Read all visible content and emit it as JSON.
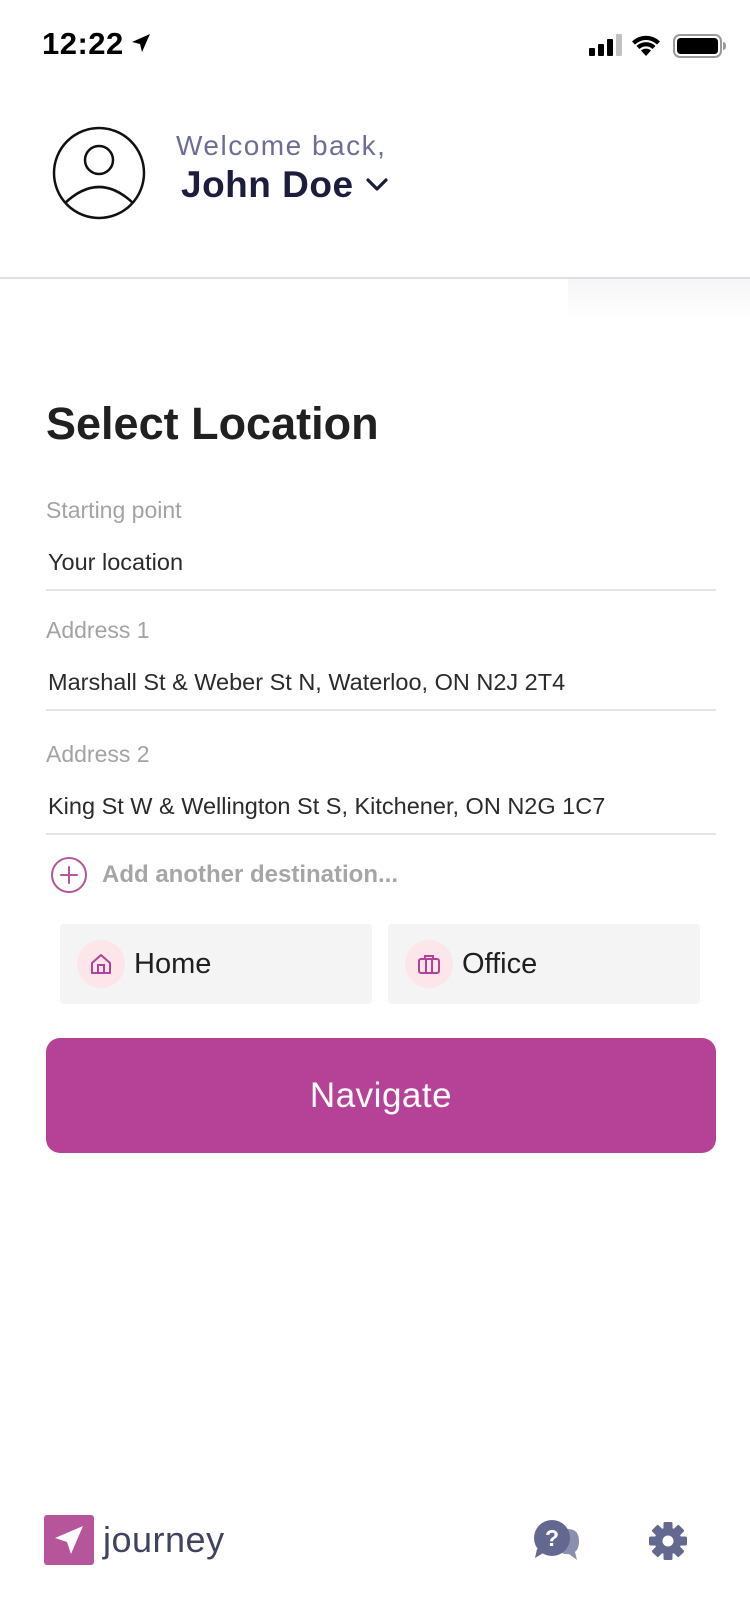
{
  "status_bar": {
    "time": "12:22"
  },
  "header": {
    "welcome": "Welcome back,",
    "user_name": "John Doe"
  },
  "form": {
    "title": "Select Location",
    "fields": [
      {
        "label": "Starting point",
        "value": "Your location"
      },
      {
        "label": "Address 1",
        "value": "Marshall St & Weber St N, Waterloo, ON N2J 2T4"
      },
      {
        "label": "Address 2",
        "value": "King St W & Wellington St S, Kitchener, ON N2G 1C7"
      }
    ],
    "add_destination": "Add another destination...",
    "quick_options": [
      {
        "label": "Home",
        "icon": "home-icon"
      },
      {
        "label": "Office",
        "icon": "briefcase-icon"
      }
    ],
    "navigate_label": "Navigate"
  },
  "footer": {
    "app_name": "journey",
    "icons": [
      "help-chat-icon",
      "gear-icon"
    ]
  },
  "colors": {
    "accent": "#b64297",
    "welcome_text": "#6c6e97",
    "name_text": "#1c1d3c",
    "quick_icon_bg": "#fde6ea",
    "footer_icon": "#626890"
  }
}
